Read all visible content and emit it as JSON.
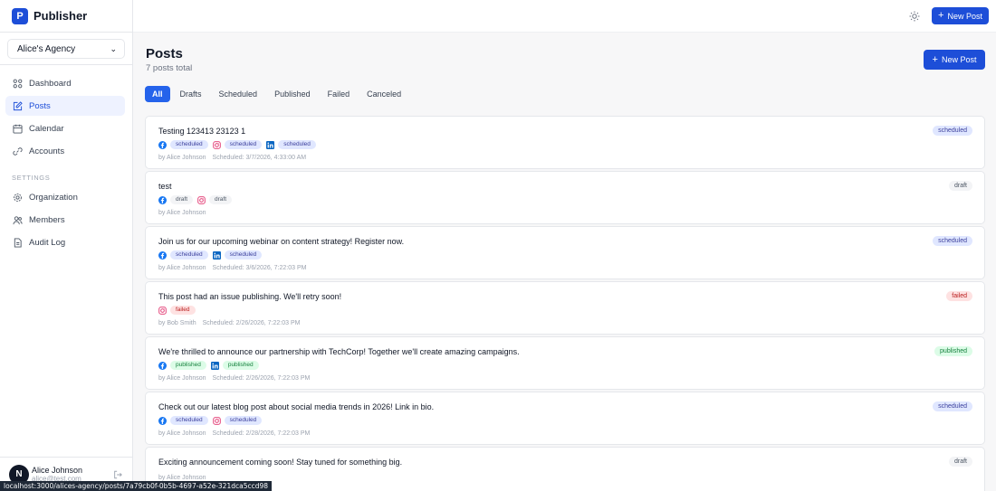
{
  "brand": {
    "logo_letter": "P",
    "name": "Publisher"
  },
  "org_switcher": {
    "value": "Alice's Agency"
  },
  "nav": [
    {
      "label": "Dashboard",
      "icon": "grid-icon",
      "active": false
    },
    {
      "label": "Posts",
      "icon": "pencil-square-icon",
      "active": true
    },
    {
      "label": "Calendar",
      "icon": "calendar-icon",
      "active": false
    },
    {
      "label": "Accounts",
      "icon": "link-icon",
      "active": false
    }
  ],
  "settings_section": "SETTINGS",
  "settings_nav": [
    {
      "label": "Organization",
      "icon": "gear-icon"
    },
    {
      "label": "Members",
      "icon": "users-icon"
    },
    {
      "label": "Audit Log",
      "icon": "document-icon"
    }
  ],
  "user": {
    "initial": "N",
    "name": "Alice Johnson",
    "email": "alice@test.com"
  },
  "topbar": {
    "new_post_label": "New Post"
  },
  "page": {
    "title": "Posts",
    "subtitle": "7 posts total",
    "new_post_label": "New Post"
  },
  "tabs": [
    "All",
    "Drafts",
    "Scheduled",
    "Published",
    "Failed",
    "Canceled"
  ],
  "active_tab": "All",
  "posts": [
    {
      "title": "Testing 123413 23123 1",
      "status": "scheduled",
      "channels": [
        {
          "network": "facebook",
          "status": "scheduled"
        },
        {
          "network": "instagram",
          "status": "scheduled"
        },
        {
          "network": "linkedin",
          "status": "scheduled"
        }
      ],
      "author": "by Alice Johnson",
      "schedule": "Scheduled: 3/7/2026, 4:33:00 AM"
    },
    {
      "title": "test",
      "status": "draft",
      "channels": [
        {
          "network": "facebook",
          "status": "draft"
        },
        {
          "network": "instagram",
          "status": "draft"
        }
      ],
      "author": "by Alice Johnson",
      "schedule": ""
    },
    {
      "title": "Join us for our upcoming webinar on content strategy! Register now.",
      "status": "scheduled",
      "channels": [
        {
          "network": "facebook",
          "status": "scheduled"
        },
        {
          "network": "linkedin",
          "status": "scheduled"
        }
      ],
      "author": "by Alice Johnson",
      "schedule": "Scheduled: 3/6/2026, 7:22:03 PM"
    },
    {
      "title": "This post had an issue publishing. We'll retry soon!",
      "status": "failed",
      "channels": [
        {
          "network": "instagram",
          "status": "failed"
        }
      ],
      "author": "by Bob Smith",
      "schedule": "Scheduled: 2/26/2026, 7:22:03 PM"
    },
    {
      "title": "We're thrilled to announce our partnership with TechCorp! Together we'll create amazing campaigns.",
      "status": "published",
      "channels": [
        {
          "network": "facebook",
          "status": "published"
        },
        {
          "network": "linkedin",
          "status": "published"
        }
      ],
      "author": "by Alice Johnson",
      "schedule": "Scheduled: 2/26/2026, 7:22:03 PM"
    },
    {
      "title": "Check out our latest blog post about social media trends in 2026! Link in bio.",
      "status": "scheduled",
      "channels": [
        {
          "network": "facebook",
          "status": "scheduled"
        },
        {
          "network": "instagram",
          "status": "scheduled"
        }
      ],
      "author": "by Alice Johnson",
      "schedule": "Scheduled: 2/28/2026, 7:22:03 PM"
    },
    {
      "title": "Exciting announcement coming soon! Stay tuned for something big.",
      "status": "draft",
      "channels": [],
      "author": "by Alice Johnson",
      "schedule": ""
    }
  ],
  "browser_status_url": "localhost:3000/alices-agency/posts/7a79cb0f-0b5b-4697-a52e-321dca5ccd98",
  "colors": {
    "accent": "#1d4ed8",
    "facebook": "#1877f2",
    "instagram": "#e1306c",
    "linkedin": "#0a66c2"
  }
}
